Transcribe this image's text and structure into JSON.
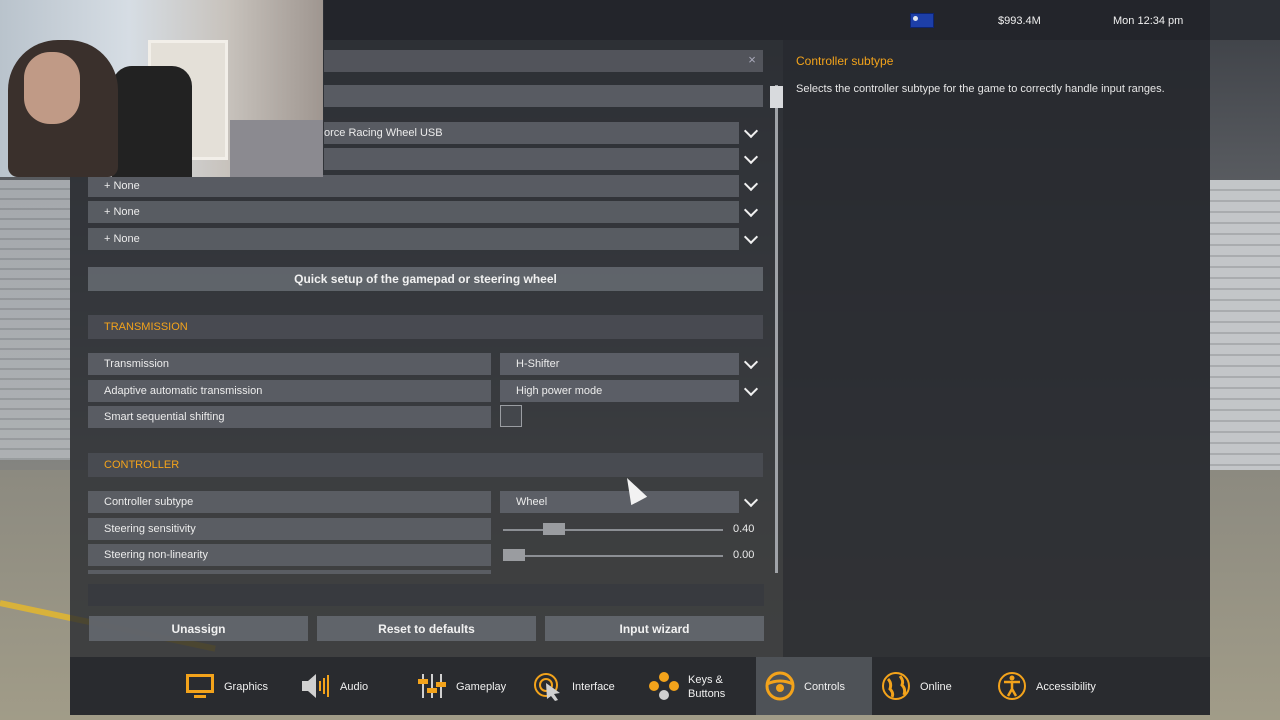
{
  "topbar": {
    "money": "$993.4M",
    "clock": "Mon 12:34 pm"
  },
  "info": {
    "title": "Controller subtype",
    "text": "Selects the controller subtype for the game to correctly handle input ranges."
  },
  "devices": {
    "primary": "orce Racing Wheel USB",
    "slots": [
      "+ None",
      "+ None",
      "+ None"
    ]
  },
  "quick_setup": "Quick setup of the gamepad or steering wheel",
  "transmission": {
    "section": "TRANSMISSION",
    "rows": [
      {
        "label": "Transmission",
        "value": "H-Shifter"
      },
      {
        "label": "Adaptive automatic transmission",
        "value": "High power mode"
      },
      {
        "label": "Smart sequential shifting",
        "value": ""
      }
    ]
  },
  "controller": {
    "section": "CONTROLLER",
    "subtype_label": "Controller subtype",
    "subtype_value": "Wheel",
    "sensitivity_label": "Steering sensitivity",
    "sensitivity_value": "0.40",
    "sensitivity_level": 0.4,
    "nonlinearity_label": "Steering non-linearity",
    "nonlinearity_value": "0.00",
    "nonlinearity_level": 0.0
  },
  "actions": {
    "unassign": "Unassign",
    "reset": "Reset to defaults",
    "wizard": "Input wizard"
  },
  "nav": [
    {
      "label": "Graphics",
      "icon": "monitor-icon"
    },
    {
      "label": "Audio",
      "icon": "speaker-icon"
    },
    {
      "label": "Gameplay",
      "icon": "sliders-icon"
    },
    {
      "label": "Interface",
      "icon": "cursor-icon"
    },
    {
      "label": "Keys &",
      "label2": "Buttons",
      "icon": "gamepad-buttons-icon"
    },
    {
      "label": "Controls",
      "icon": "steering-wheel-icon"
    },
    {
      "label": "Online",
      "icon": "globe-icon"
    },
    {
      "label": "Accessibility",
      "icon": "accessibility-icon"
    }
  ],
  "colors": {
    "accent": "#f3a31b",
    "active_tab": "#50545a"
  }
}
